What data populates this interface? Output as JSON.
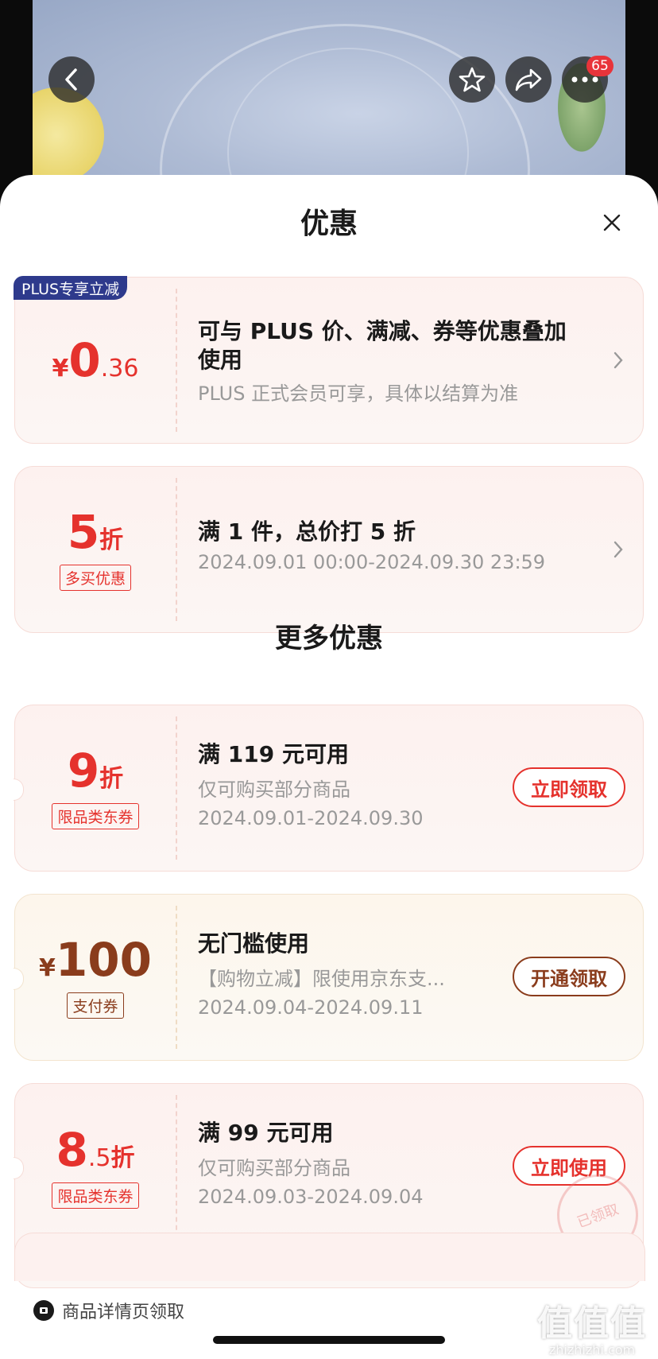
{
  "header": {
    "badge_count": "65",
    "icons": [
      "back-arrow-icon",
      "star-icon",
      "share-icon",
      "more-icon"
    ]
  },
  "sheet": {
    "title": "优惠",
    "close_icon": "close-icon"
  },
  "cards": [
    {
      "corner_label": "PLUS专享立减",
      "currency": "¥",
      "amount_int": "0",
      "amount_dec": ".36",
      "line1_a": "可与 PLUS 价、满减、券等优惠叠加",
      "line1_b": "使用",
      "line2": "PLUS 正式会员可享，具体以结算为准"
    },
    {
      "amount_int": "5",
      "amount_unit": "折",
      "tag": "多买优惠",
      "line1": "满 1 件，总价打 5 折",
      "line2": "2024.09.01 00:00-2024.09.30 23:59"
    }
  ],
  "more_title": "更多优惠",
  "more_cards": [
    {
      "amount_int": "9",
      "amount_unit": "折",
      "tag": "限品类东券",
      "line1": "满 119 元可用",
      "line2": "仅可购买部分商品",
      "line3": "2024.09.01-2024.09.30",
      "button": "立即领取"
    },
    {
      "currency": "¥",
      "amount_int": "100",
      "tag": "支付券",
      "line1": "无门槛使用",
      "line2": "【购物立减】限使用京东支...",
      "line3": "2024.09.04-2024.09.11",
      "button": "开通领取"
    },
    {
      "amount_int": "8",
      "amount_dec": ".5",
      "amount_unit": "折",
      "tag": "限品类东券",
      "line1": "满 99 元可用",
      "line2": "仅可购买部分商品",
      "line3": "2024.09.03-2024.09.04",
      "button": "立即使用",
      "stamp": "已领取"
    }
  ],
  "source_text": "商品详情页领取",
  "watermark": {
    "logo": "值值值",
    "url": "zhizhizhi.com"
  },
  "colors": {
    "accent_red": "#e5322d",
    "accent_brown": "#8a3c1c",
    "plus_blue": "#2e3a8c"
  }
}
